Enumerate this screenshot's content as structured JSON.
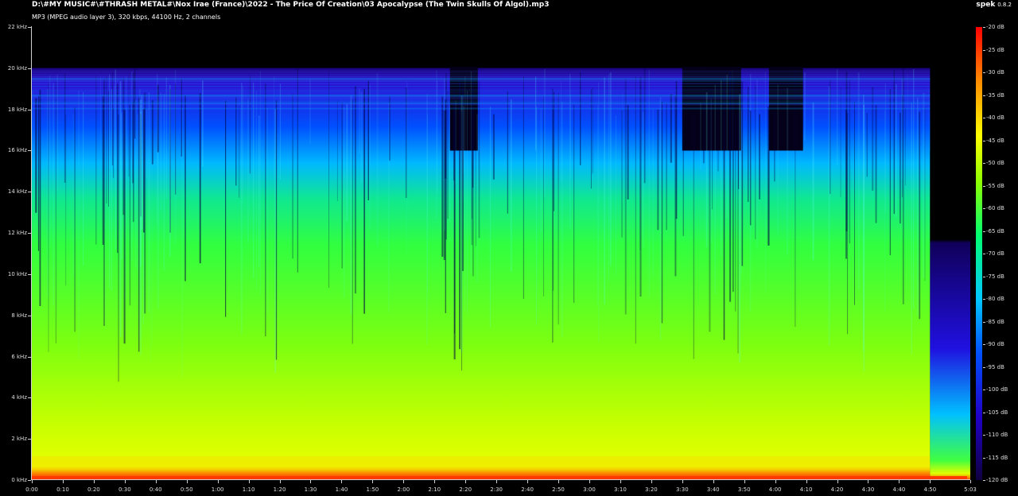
{
  "file": {
    "title": "D:\\#MY MUSIC#\\#THRASH METAL#\\Nox Irae (France)\\2022 - The Price Of Creation\\03 Apocalypse (The Twin Skulls Of Algol).mp3",
    "info": "MP3 (MPEG audio layer 3), 320 kbps, 44100 Hz, 2 channels"
  },
  "app": {
    "name": "spek",
    "version": "0.8.2"
  },
  "frequency_axis": {
    "labels": [
      "22 kHz",
      "20 kHz",
      "18 kHz",
      "16 kHz",
      "14 kHz",
      "12 kHz",
      "10 kHz",
      "8 kHz",
      "6 kHz",
      "4 kHz",
      "2 kHz",
      "0 kHz"
    ]
  },
  "time_axis": {
    "labels": [
      "0:00",
      "0:10",
      "0:20",
      "0:30",
      "0:40",
      "0:50",
      "1:00",
      "1:10",
      "1:20",
      "1:30",
      "1:40",
      "1:50",
      "2:00",
      "2:10",
      "2:20",
      "2:30",
      "2:40",
      "2:50",
      "3:00",
      "3:10",
      "3:20",
      "3:30",
      "3:40",
      "3:50",
      "4:00",
      "4:10",
      "4:20",
      "4:30",
      "4:40",
      "4:50",
      "5:03"
    ]
  },
  "colorbar": {
    "labels": [
      "-20 dB",
      "-25 dB",
      "-30 dB",
      "-35 dB",
      "-40 dB",
      "-45 dB",
      "-50 dB",
      "-55 dB",
      "-60 dB",
      "-65 dB",
      "-70 dB",
      "-75 dB",
      "-80 dB",
      "-85 dB",
      "-90 dB",
      "-95 dB",
      "-100 dB",
      "-105 dB",
      "-110 dB",
      "-115 dB",
      "-120 dB"
    ]
  },
  "spectrogram": {
    "duration_seconds": 303,
    "max_frequency_khz": 22,
    "cutoff_khz": 20,
    "quiet_sections_seconds": [
      [
        135,
        144
      ],
      [
        210,
        218
      ],
      [
        216,
        229
      ],
      [
        238,
        249
      ]
    ],
    "reduced_cutoff_khz": 16,
    "fadeout_start_seconds": 290
  }
}
